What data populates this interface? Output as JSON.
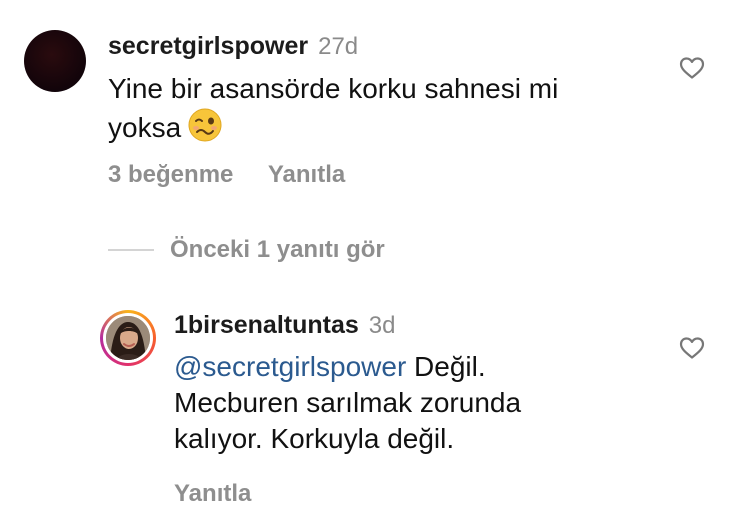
{
  "comment1": {
    "username": "secretgirlspower",
    "time": "27d",
    "text_line1": "Yine bir asansörde korku sahnesi mi",
    "text_line2": "yoksa",
    "emoji": "woozy-face-emoji",
    "likes": "3 beğenme",
    "reply": "Yanıtla"
  },
  "replies_toggle": "Önceki 1 yanıtı gör",
  "comment2": {
    "username": "1birsenaltuntas",
    "time": "3d",
    "mention": "@secretgirlspower",
    "text_line1_rest": " Değil.",
    "text_line2": "Mecburen sarılmak zorunda",
    "text_line3": "kalıyor. Korkuyla değil.",
    "reply": "Yanıtla"
  },
  "colors": {
    "mention": "#2b5a8f",
    "meta": "#8e8e8e",
    "story_ring": "#e1306c"
  },
  "icons": {
    "like": "heart-outline-icon"
  }
}
